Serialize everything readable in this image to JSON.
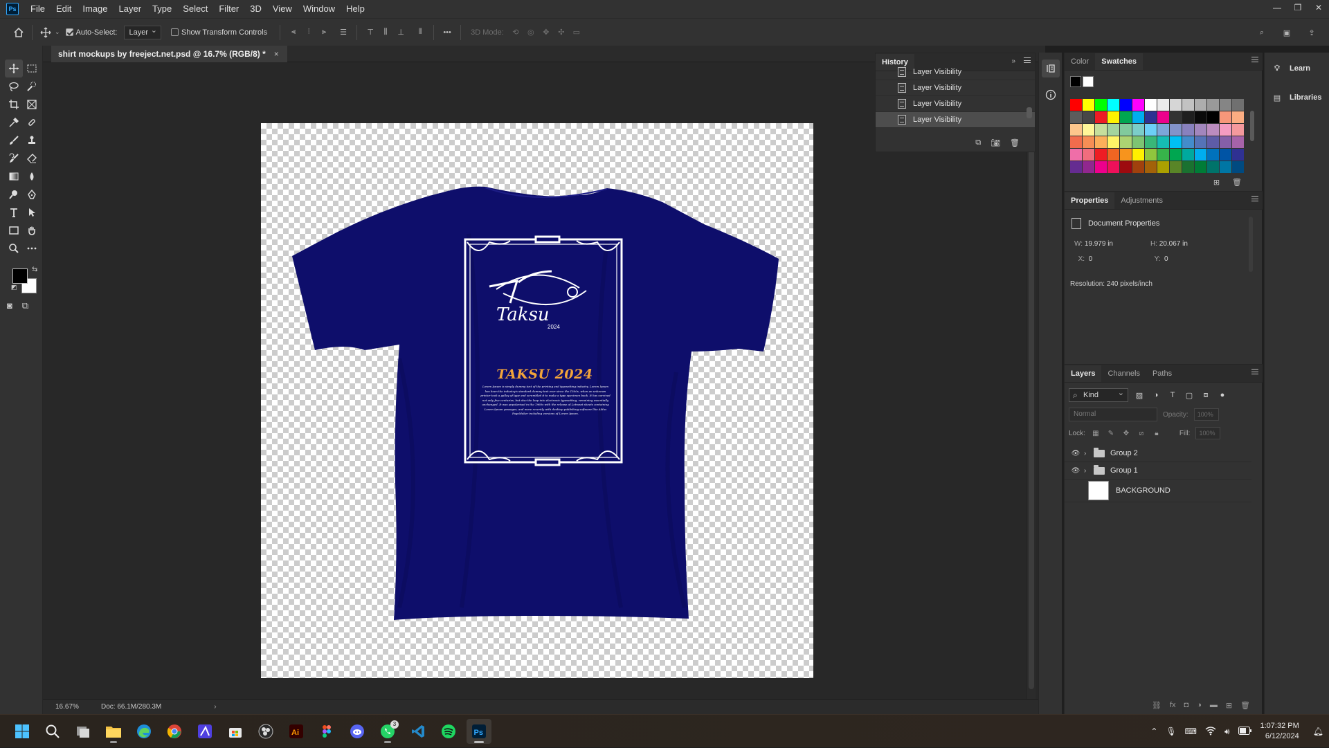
{
  "app": {
    "logo": "Ps",
    "menu": [
      "File",
      "Edit",
      "Image",
      "Layer",
      "Type",
      "Select",
      "Filter",
      "3D",
      "View",
      "Window",
      "Help"
    ],
    "window_controls": [
      "minimize-icon",
      "restore-icon",
      "close-icon"
    ]
  },
  "options_bar": {
    "auto_select_label": "Auto-Select:",
    "auto_select_checked": true,
    "auto_select_target": "Layer",
    "transform_controls_label": "Show Transform Controls",
    "transform_controls_checked": false,
    "mode_3d_label": "3D Mode:"
  },
  "document": {
    "tab_title": "shirt mockups by freeject.net.psd @ 16.7% (RGB/8) *",
    "zoom": "16.67%",
    "doc_size": "Doc: 66.1M/280.3M",
    "design": {
      "logo_word": "Taksu",
      "logo_year": "2024",
      "headline": "TAKSU 2024",
      "body_text": "Lorem Ipsum is simply dummy text of the printing and typesetting industry. Lorem Ipsum has been the industry's standard dummy text ever since the 1500s, when an unknown printer took a galley of type and scrambled it to make a type specimen book. It has survived not only five centuries, but also the leap into electronic typesetting, remaining essentially unchanged. It was popularised in the 1960s with the release of Letraset sheets containing Lorem Ipsum passages, and more recently with desktop publishing software like Aldus PageMaker including versions of Lorem Ipsum.",
      "shirt_color": "#0e0e6b",
      "accent_color": "#f2a43a"
    }
  },
  "history": {
    "tab": "History",
    "items": [
      "Layer Visibility",
      "Layer Visibility",
      "Layer Visibility",
      "Layer Visibility"
    ],
    "selected_index": 3
  },
  "swatches_panel": {
    "tabs": [
      "Color",
      "Swatches"
    ],
    "active_tab": "Swatches",
    "colors": [
      "#ff0000",
      "#ffff00",
      "#00ff00",
      "#00ffff",
      "#0000ff",
      "#ff00ff",
      "#ffffff",
      "#ebebeb",
      "#d6d6d6",
      "#c2c2c2",
      "#adadad",
      "#999999",
      "#858585",
      "#707070",
      "#5c5c5c",
      "#474747",
      "#ed1c24",
      "#fff200",
      "#00a651",
      "#00aeef",
      "#2e3192",
      "#ec008c",
      "#333333",
      "#1f1f1f",
      "#0a0a0a",
      "#000000",
      "#f7977a",
      "#fbad82",
      "#fdc68c",
      "#fff799",
      "#c6df9c",
      "#a4d49d",
      "#81ca9d",
      "#7bcdc9",
      "#6ccff7",
      "#7ca6d8",
      "#8293ca",
      "#8881be",
      "#a286bd",
      "#bc8cbf",
      "#f49bc1",
      "#f5999d",
      "#f16c4d",
      "#f68e55",
      "#fbaf5a",
      "#fff467",
      "#acd372",
      "#7dc473",
      "#39b778",
      "#16bcb4",
      "#00bff3",
      "#438ccb",
      "#5573b7",
      "#5e5ca7",
      "#855fa8",
      "#a763a9",
      "#ef6ea8",
      "#f16d7e",
      "#ee1d24",
      "#f16522",
      "#f7941d",
      "#fff100",
      "#8fc63d",
      "#37b44a",
      "#00a650",
      "#00a99e",
      "#00aeef",
      "#0072bc",
      "#0054a5",
      "#2f3192",
      "#652c91",
      "#91278f",
      "#ed008c",
      "#ee105a",
      "#9d0a0f",
      "#a1410d",
      "#a36209",
      "#aba000",
      "#598527",
      "#1a7130",
      "#007c37",
      "#00736a",
      "#0076a4",
      "#004a80"
    ]
  },
  "properties": {
    "tabs": [
      "Properties",
      "Adjustments"
    ],
    "active_tab": "Properties",
    "section": "Document Properties",
    "w_label": "W:",
    "w_value": "19.979 in",
    "h_label": "H:",
    "h_value": "20.067 in",
    "x_label": "X:",
    "x_value": "0",
    "y_label": "Y:",
    "y_value": "0",
    "resolution": "Resolution: 240 pixels/inch"
  },
  "layers_panel": {
    "tabs": [
      "Layers",
      "Channels",
      "Paths"
    ],
    "active_tab": "Layers",
    "filter_kind": "Kind",
    "blend_mode": "Normal",
    "opacity_label": "Opacity:",
    "opacity_value": "100%",
    "lock_label": "Lock:",
    "fill_label": "Fill:",
    "fill_value": "100%",
    "layers": [
      {
        "name": "Group 2",
        "type": "group",
        "visible": true
      },
      {
        "name": "Group 1",
        "type": "group",
        "visible": true
      },
      {
        "name": "BACKGROUND",
        "type": "pixel",
        "visible": false
      }
    ]
  },
  "side_panels": {
    "learn": "Learn",
    "libraries": "Libraries"
  },
  "taskbar": {
    "apps": [
      "windows-start-icon",
      "search-icon",
      "task-view-icon",
      "file-explorer-icon",
      "edge-icon",
      "chrome-icon",
      "affinity-icon",
      "store-icon",
      "obs-icon",
      "illustrator-icon",
      "figma-icon",
      "discord-icon",
      "whatsapp-icon",
      "vscode-icon",
      "spotify-icon",
      "photoshop-icon"
    ],
    "whatsapp_badge": "3",
    "time": "1:07:32 PM",
    "date": "6/12/2024"
  }
}
